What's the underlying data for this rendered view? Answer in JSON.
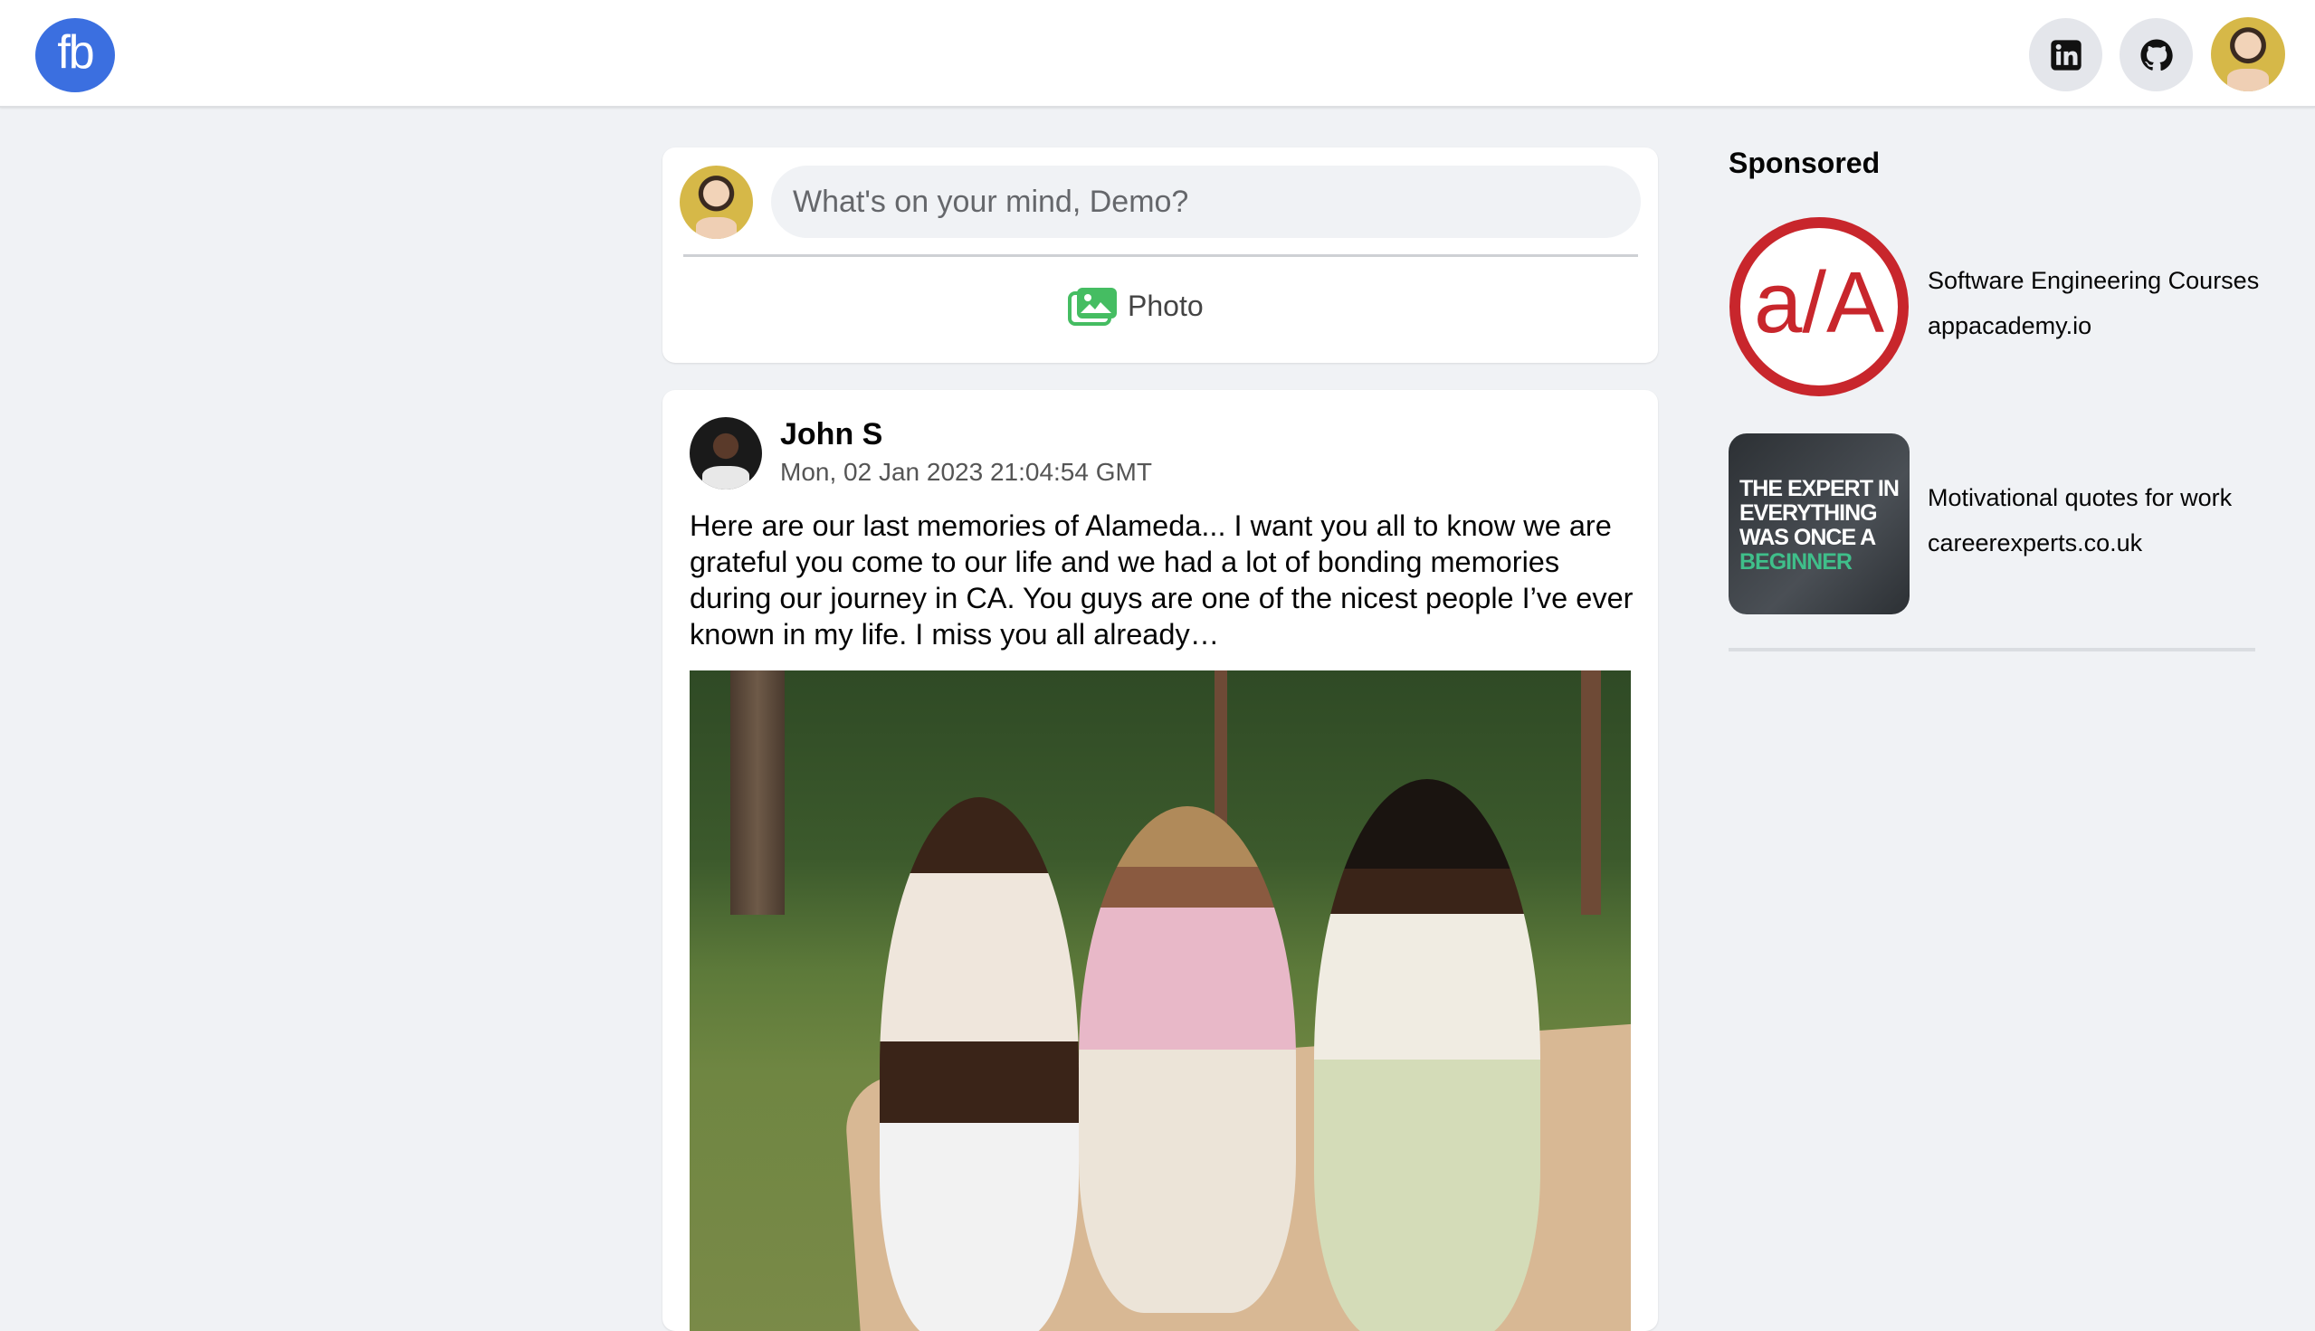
{
  "header": {
    "logo_text": "fb",
    "nav_icons": [
      "linkedin-icon",
      "github-icon"
    ],
    "brand_color": "#3b6fe0"
  },
  "composer": {
    "placeholder": "What's on your mind, Demo?",
    "photo_label": "Photo",
    "photo_icon": "photo-gallery-icon",
    "photo_icon_color": "#45bd62"
  },
  "post": {
    "author": "John S",
    "timestamp": "Mon, 02 Jan 2023 21:04:54 GMT",
    "text": "Here are our last memories of Alameda... I want you all to know we are grateful you come to our life and we had a lot of bonding memories during our journey in CA. You guys are one of the nicest people I’ve ever known in my life. I miss you all already…"
  },
  "sponsored": {
    "title": "Sponsored",
    "ads": [
      {
        "name": "Software Engineering Courses",
        "domain": "appacademy.io",
        "logo_text": "a/A",
        "logo_color": "#c8262c"
      },
      {
        "name": "Motivational quotes for work",
        "domain": "careerexperts.co.uk",
        "thumb_lines": [
          "THE EXPERT IN",
          "EVERYTHING",
          "WAS ONCE A",
          "BEGINNER"
        ],
        "accent": "#3fbf8a"
      }
    ]
  }
}
